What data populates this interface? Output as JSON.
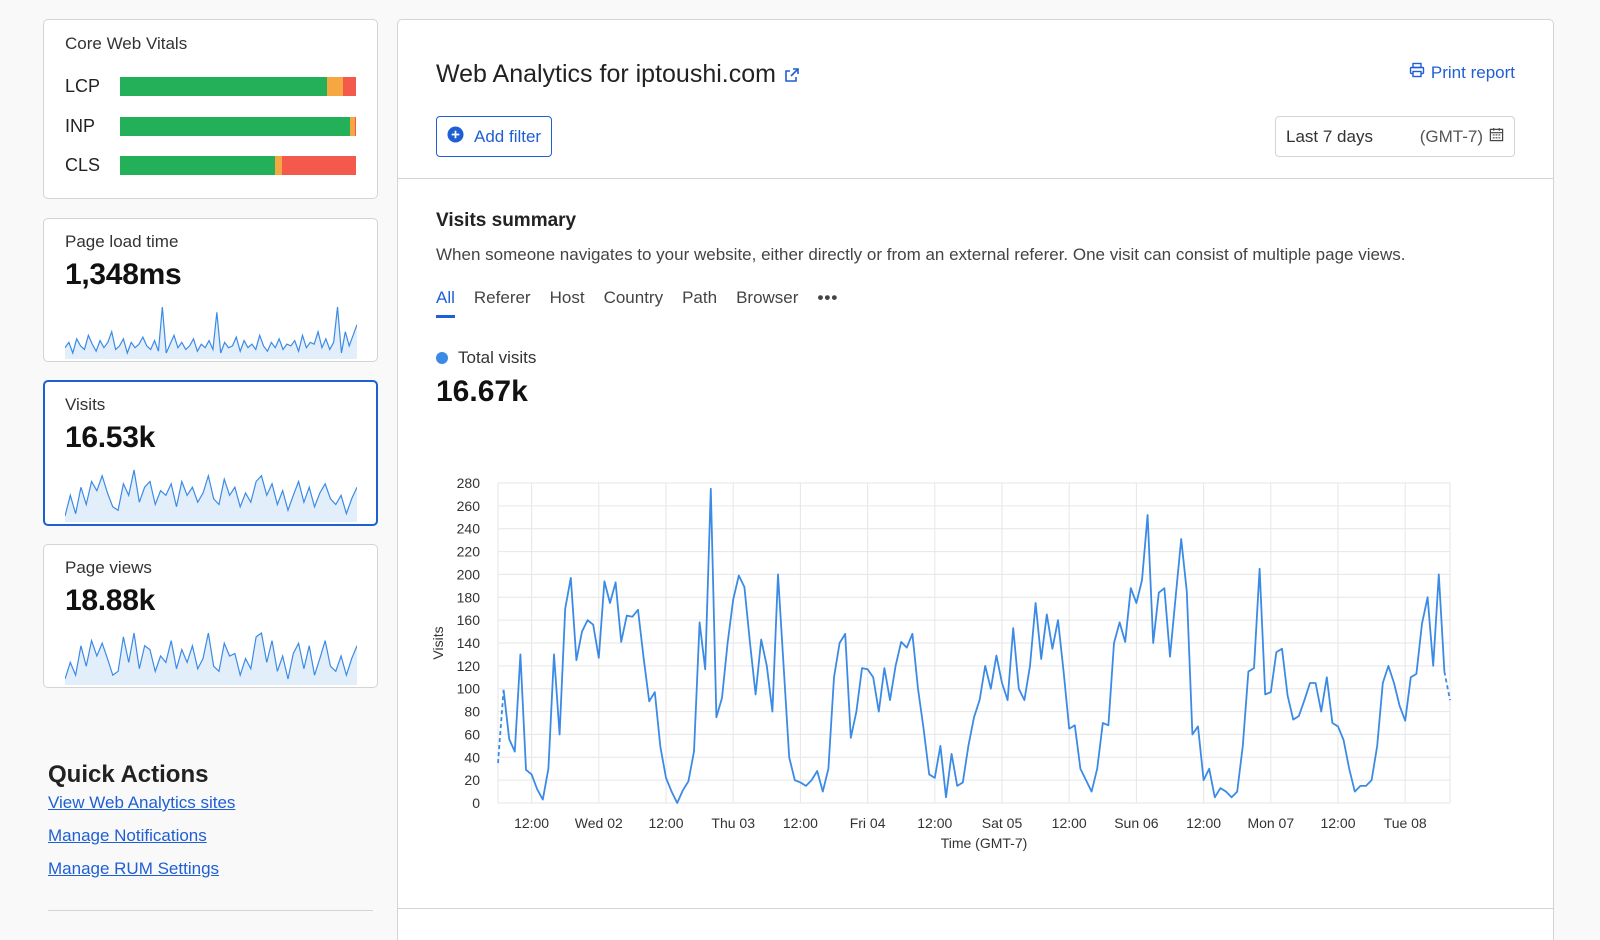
{
  "sidebar": {
    "core_web_vitals": {
      "title": "Core Web Vitals",
      "metrics": [
        {
          "label": "LCP",
          "good": 0.875,
          "needs_improvement": 0.07,
          "poor": 0.055
        },
        {
          "label": "INP",
          "good": 0.975,
          "needs_improvement": 0.02,
          "poor": 0.005
        },
        {
          "label": "CLS",
          "good": 0.655,
          "needs_improvement": 0.03,
          "poor": 0.315
        }
      ]
    },
    "page_load_time": {
      "title": "Page load time",
      "value": "1,348ms"
    },
    "visits": {
      "title": "Visits",
      "value": "16.53k"
    },
    "page_views": {
      "title": "Page views",
      "value": "18.88k"
    }
  },
  "quick_actions": {
    "title": "Quick Actions",
    "links": [
      "View Web Analytics sites",
      "Manage Notifications",
      "Manage RUM Settings"
    ]
  },
  "main": {
    "title": "Web Analytics for iptoushi.com",
    "print_label": "Print report",
    "add_filter_label": "Add filter",
    "date_range": "Last 7 days",
    "timezone": "(GMT-7)",
    "summary": {
      "title": "Visits summary",
      "description": "When someone navigates to your website, either directly or from an external referer. One visit can consist of multiple page views."
    },
    "tabs": [
      "All",
      "Referer",
      "Host",
      "Country",
      "Path",
      "Browser"
    ],
    "legend_label": "Total visits",
    "total_value": "16.67k"
  },
  "colors": {
    "accent": "#1f5fd4",
    "series": "#3b8be6",
    "good": "#23b058",
    "needs_improvement": "#f5a742",
    "poor": "#f45a4b"
  },
  "chart_data": {
    "type": "line",
    "title": "",
    "xlabel": "Time (GMT-7)",
    "ylabel": "Visits",
    "ylim": [
      0,
      280
    ],
    "yticks": [
      0,
      20,
      40,
      60,
      80,
      100,
      120,
      140,
      160,
      180,
      200,
      220,
      240,
      260,
      280
    ],
    "xticks": [
      "12:00",
      "Wed 02",
      "12:00",
      "Thu 03",
      "12:00",
      "Fri 04",
      "12:00",
      "Sat 05",
      "12:00",
      "Sun 06",
      "12:00",
      "Mon 07",
      "12:00",
      "Tue 08"
    ],
    "x_start_hour": 6,
    "grid": true,
    "series": [
      {
        "name": "Total visits",
        "values": [
          35,
          99,
          56,
          45,
          130,
          29,
          25,
          12,
          3,
          30,
          130,
          60,
          170,
          197,
          125,
          150,
          160,
          156,
          127,
          194,
          175,
          193,
          141,
          164,
          163,
          169,
          127,
          89,
          97,
          49,
          22,
          10,
          0,
          11,
          19,
          45,
          158,
          117,
          275,
          75,
          92,
          140,
          178,
          199,
          189,
          140,
          95,
          143,
          120,
          80,
          200,
          120,
          40,
          20,
          18,
          15,
          20,
          28,
          10,
          30,
          110,
          140,
          148,
          57,
          80,
          118,
          117,
          110,
          80,
          118,
          90,
          120,
          141,
          136,
          148,
          100,
          65,
          25,
          22,
          50,
          5,
          43,
          15,
          18,
          50,
          75,
          90,
          120,
          100,
          129,
          105,
          90,
          153,
          100,
          90,
          120,
          175,
          126,
          165,
          135,
          160,
          115,
          65,
          68,
          30,
          20,
          10,
          30,
          70,
          68,
          140,
          158,
          141,
          188,
          175,
          195,
          252,
          140,
          184,
          188,
          128,
          180,
          231,
          185,
          60,
          67,
          20,
          30,
          5,
          13,
          10,
          5,
          10,
          50,
          115,
          118,
          205,
          95,
          97,
          132,
          135,
          94,
          73,
          76,
          90,
          105,
          105,
          80,
          110,
          70,
          67,
          55,
          30,
          10,
          15,
          15,
          20,
          50,
          105,
          120,
          105,
          85,
          72,
          110,
          113,
          157,
          180,
          120,
          200,
          115,
          90
        ]
      }
    ]
  },
  "sparklines": {
    "page_load_time": [
      15,
      18,
      12,
      20,
      16,
      14,
      22,
      17,
      13,
      19,
      15,
      18,
      24,
      14,
      16,
      20,
      12,
      18,
      15,
      17,
      21,
      16,
      14,
      19,
      13,
      38,
      12,
      17,
      22,
      15,
      18,
      14,
      16,
      20,
      13,
      17,
      15,
      19,
      14,
      35,
      12,
      18,
      15,
      16,
      21,
      13,
      19,
      15,
      17,
      14,
      22,
      16,
      13,
      18,
      15,
      20,
      14,
      17,
      16,
      19,
      13,
      22,
      15,
      18,
      17,
      24,
      15,
      20,
      14,
      18,
      38,
      12,
      24,
      16,
      22,
      28
    ],
    "visits": [
      10,
      28,
      12,
      35,
      20,
      40,
      32,
      45,
      30,
      18,
      15,
      38,
      28,
      50,
      22,
      35,
      40,
      20,
      32,
      28,
      38,
      18,
      40,
      28,
      35,
      22,
      30,
      45,
      25,
      20,
      42,
      28,
      35,
      18,
      30,
      22,
      40,
      45,
      28,
      38,
      20,
      32,
      15,
      28,
      40,
      22,
      35,
      18,
      30,
      38,
      25,
      20,
      28,
      12,
      25,
      35
    ],
    "page_views": [
      12,
      25,
      15,
      38,
      22,
      42,
      30,
      40,
      28,
      15,
      18,
      45,
      25,
      48,
      20,
      38,
      35,
      18,
      30,
      25,
      42,
      20,
      35,
      25,
      38,
      20,
      28,
      48,
      22,
      18,
      40,
      30,
      32,
      15,
      28,
      20,
      45,
      48,
      25,
      42,
      18,
      30,
      12,
      32,
      40,
      20,
      38,
      15,
      28,
      42,
      22,
      18,
      30,
      15,
      28,
      38
    ]
  }
}
